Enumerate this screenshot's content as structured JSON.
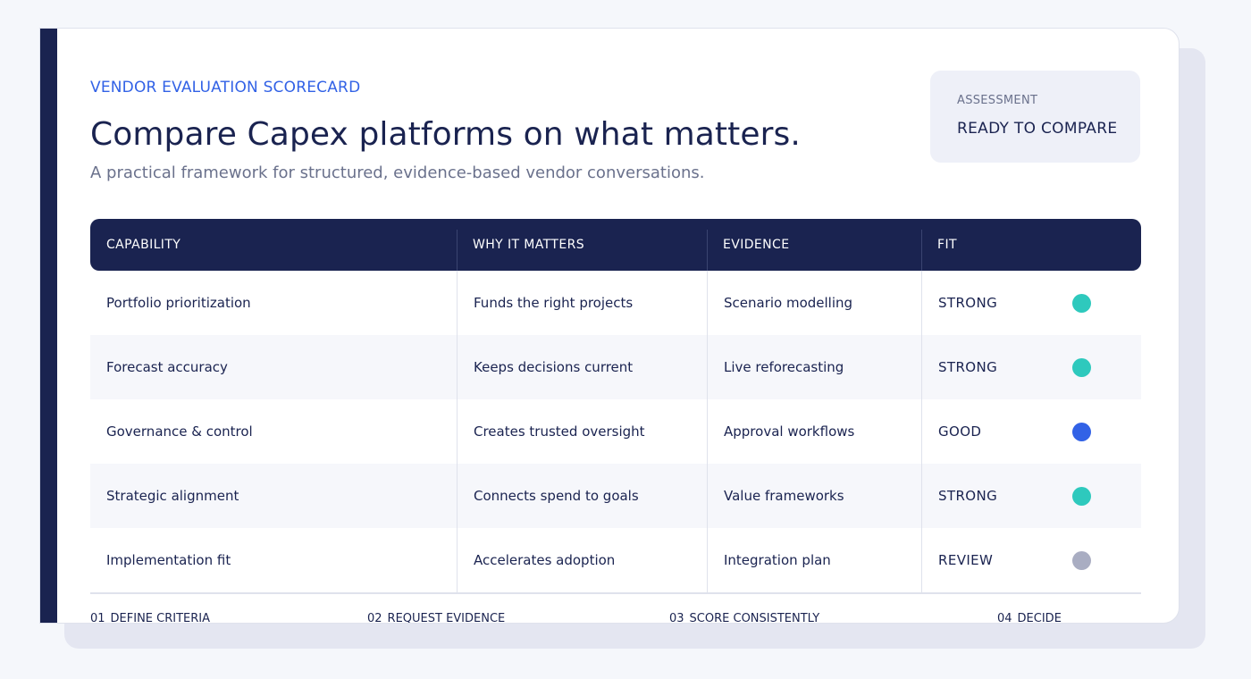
{
  "eyebrow": "VENDOR EVALUATION SCORECARD",
  "title": "Compare Capex platforms on what matters.",
  "subtitle": "A practical framework for structured, evidence-based vendor conversations.",
  "status": {
    "label": "ASSESSMENT",
    "value": "READY TO COMPARE"
  },
  "table": {
    "headers": [
      "CAPABILITY",
      "WHY IT MATTERS",
      "EVIDENCE",
      "FIT"
    ],
    "rows": [
      {
        "capability": "Portfolio prioritization",
        "why": "Funds the right projects",
        "evidence": "Scenario modelling",
        "fit": "STRONG",
        "fit_color": "#2ec9bd"
      },
      {
        "capability": "Forecast accuracy",
        "why": "Keeps decisions current",
        "evidence": "Live reforecasting",
        "fit": "STRONG",
        "fit_color": "#2ec9bd"
      },
      {
        "capability": "Governance & control",
        "why": "Creates trusted oversight",
        "evidence": "Approval workflows",
        "fit": "GOOD",
        "fit_color": "#3262e6"
      },
      {
        "capability": "Strategic alignment",
        "why": "Connects spend to goals",
        "evidence": "Value frameworks",
        "fit": "STRONG",
        "fit_color": "#2ec9bd"
      },
      {
        "capability": "Implementation fit",
        "why": "Accelerates adoption",
        "evidence": "Integration plan",
        "fit": "REVIEW",
        "fit_color": "#a9adc2"
      }
    ]
  },
  "steps": [
    {
      "num": "01",
      "label": "DEFINE CRITERIA"
    },
    {
      "num": "02",
      "label": "REQUEST EVIDENCE"
    },
    {
      "num": "03",
      "label": "SCORE CONSISTENTLY"
    },
    {
      "num": "04",
      "label": "DECIDE"
    }
  ],
  "colors": {
    "navy": "#1a2350",
    "accent_blue": "#3262e6",
    "teal": "#2ec9bd",
    "grey": "#a9adc2"
  }
}
